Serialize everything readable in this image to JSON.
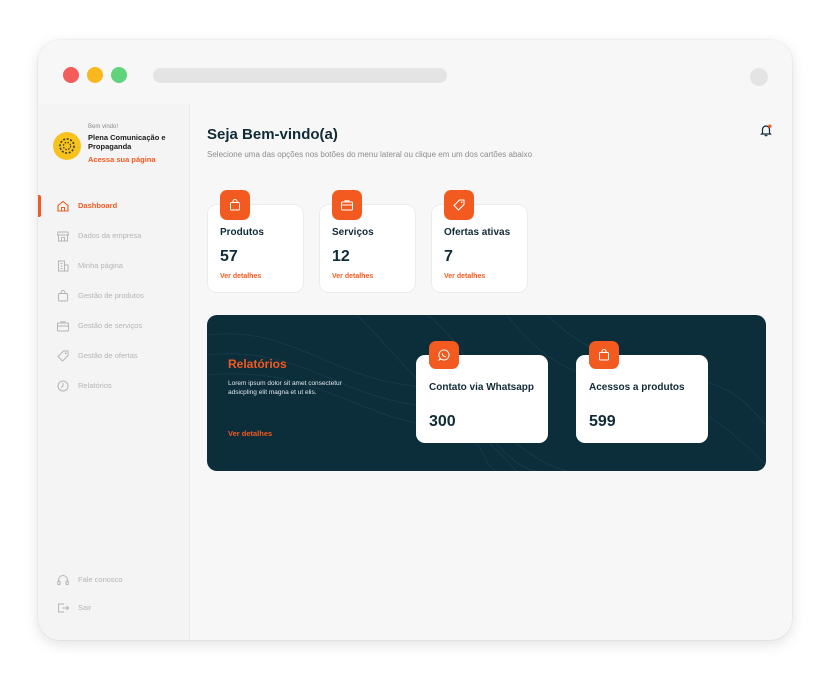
{
  "colors": {
    "accent": "#f25a1f",
    "dark_panel": "#0c2d3a",
    "heading": "#102a36",
    "traffic_red": "#f45b5b",
    "traffic_yellow": "#f9b81e",
    "traffic_green": "#5fd47b",
    "logo_yellow": "#f7c21c"
  },
  "profile": {
    "welcome": "Bem vindo!",
    "company": "Plena Comunicação e Propaganda",
    "link": "Acessa sua página"
  },
  "sidebar": {
    "items": [
      {
        "label": "Dashboard",
        "icon": "home-icon",
        "active": true
      },
      {
        "label": "Dados da empresa",
        "icon": "store-icon",
        "active": false
      },
      {
        "label": "Minha página",
        "icon": "building-icon",
        "active": false
      },
      {
        "label": "Gestão de produtos",
        "icon": "bag-icon",
        "active": false
      },
      {
        "label": "Gestão de serviços",
        "icon": "briefcase-icon",
        "active": false
      },
      {
        "label": "Gestão de ofertas",
        "icon": "tag-icon",
        "active": false
      },
      {
        "label": "Relatórios",
        "icon": "clock-icon",
        "active": false
      }
    ],
    "footer": [
      {
        "label": "Fale conosco",
        "icon": "headset-icon"
      },
      {
        "label": "Sair",
        "icon": "logout-icon"
      }
    ]
  },
  "header": {
    "title": "Seja Bem-vindo(a)",
    "subtitle": "Selecione uma das opções nos botões do menu lateral ou clique em um dos cartões abaixo",
    "notification_icon": "bell-icon"
  },
  "cards": [
    {
      "title": "Produtos",
      "value": "57",
      "link": "Ver detalhes",
      "icon": "bag-icon"
    },
    {
      "title": "Serviços",
      "value": "12",
      "link": "Ver detalhes",
      "icon": "briefcase-icon"
    },
    {
      "title": "Ofertas ativas",
      "value": "7",
      "link": "Ver detalhes",
      "icon": "tag-icon"
    }
  ],
  "reports": {
    "title": "Relatórios",
    "description": "Lorem ipsum dolor sit amet consectetur adsicpling elit magna et ut elis.",
    "link": "Ver detalhes",
    "cards": [
      {
        "title": "Contato via Whatsapp",
        "value": "300",
        "icon": "whatsapp-icon"
      },
      {
        "title": "Acessos a produtos",
        "value": "599",
        "icon": "bag-icon"
      }
    ]
  }
}
